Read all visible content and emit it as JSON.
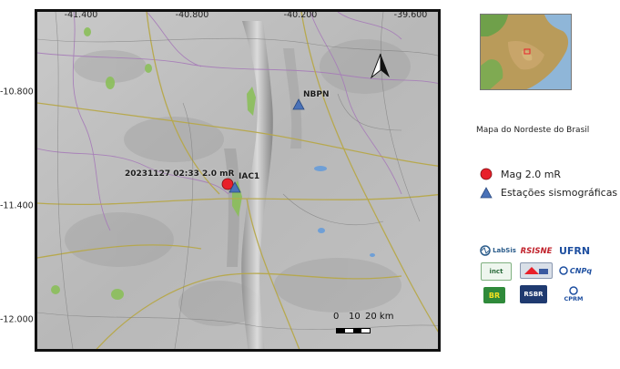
{
  "map": {
    "lon_ticks": [
      "-41.400",
      "-40.800",
      "-40.200",
      "-39.600"
    ],
    "lat_ticks": [
      "-10.800",
      "-11.400",
      "-12.000"
    ],
    "event_label": "20231127 02:33 2.0 mR",
    "station_labels": [
      "NBPN",
      "IAC1"
    ],
    "scale_labels": [
      "0",
      "10",
      "20 km"
    ]
  },
  "inset": {
    "caption": "Mapa do  Nordeste do Brasil"
  },
  "legend": {
    "items": [
      {
        "label": "Mag 2.0 mR",
        "symbol": "red-circle",
        "color": "#e8202a"
      },
      {
        "label": "Estações sismográficas",
        "symbol": "blue-triangle",
        "color": "#4a72b8"
      }
    ]
  },
  "logos": {
    "labsis": "LabSis",
    "rsisne": "RSISNE",
    "ufrn": "UFRN",
    "inct": "inct",
    "cnpq": "CNPq",
    "rsbr": "RSBR",
    "cprm": "CPRM",
    "petrobras": "BR"
  },
  "colors": {
    "event": "#e8202a",
    "station": "#4a72b8",
    "terrain": "#bdbdbd"
  }
}
